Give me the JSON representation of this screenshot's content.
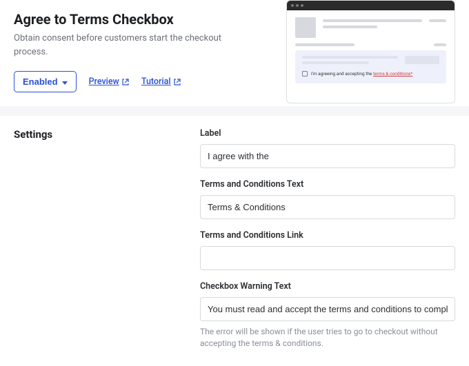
{
  "header": {
    "title": "Agree to Terms Checkbox",
    "description": "Obtain consent before customers start the checkout process.",
    "enabled_label": "Enabled",
    "preview_link": "Preview",
    "tutorial_link": "Tutorial"
  },
  "preview_mock": {
    "consent_text_prefix": "I'm agreeing and accepting the ",
    "consent_link_text": "terms & conditions*"
  },
  "settings": {
    "heading": "Settings",
    "fields": {
      "label": {
        "label": "Label",
        "value": "I agree with the"
      },
      "terms_text": {
        "label": "Terms and Conditions Text",
        "value": "Terms & Conditions"
      },
      "terms_link": {
        "label": "Terms and Conditions Link",
        "value": ""
      },
      "warning_text": {
        "label": "Checkbox Warning Text",
        "value": "You must read and accept the terms and conditions to complete checkout",
        "help": "The error will be shown if the user tries to go to checkout without accepting the terms & conditions."
      }
    }
  }
}
